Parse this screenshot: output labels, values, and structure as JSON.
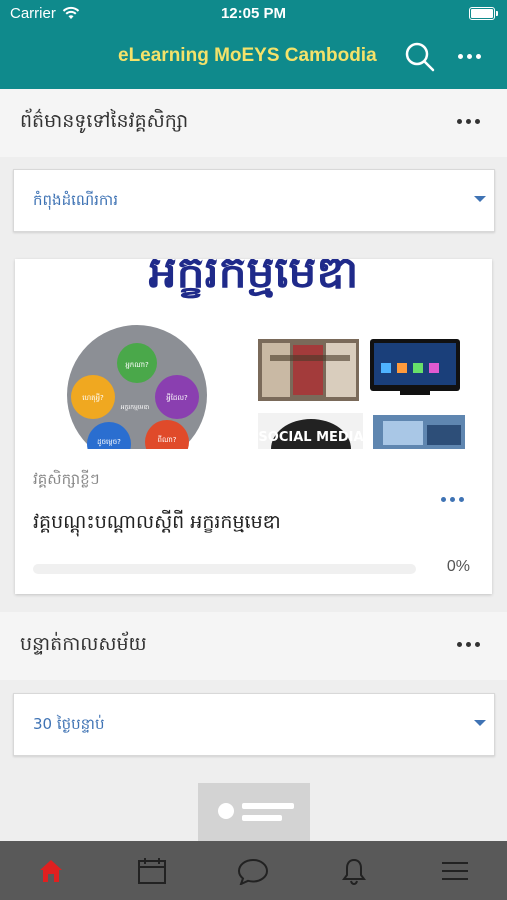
{
  "status_bar": {
    "carrier": "Carrier",
    "time": "12:05 PM"
  },
  "header": {
    "title": "eLearning MoEYS Cambodia",
    "search_icon": "search-icon",
    "more_icon": "more-icon"
  },
  "sections": {
    "news": {
      "title": "ព័ត៌មានទូទៅនៃវគ្គសិក្សា"
    },
    "course_filter": {
      "selected": "កំពុងដំណើរការ"
    },
    "timeline": {
      "title": "បន្ទាត់កាលសម័យ"
    },
    "timeline_filter": {
      "selected": "30 ថ្ងៃបន្ទាប់"
    }
  },
  "course": {
    "banner_title": "អក្ខរកម្មមេឌា",
    "banner_circle_labels": [
      "អ្នកណា?",
      "ហេតុអ្វី?",
      "អ្វីដែល?",
      "អក្ខរកម្មមេឌា",
      "ពីណា?",
      "ដូចម្តេច?"
    ],
    "banner_thumb_label": "SOCIAL MEDIA",
    "category": "វគ្គសិក្សាខ្លីៗ",
    "name": "វគ្គបណ្តុះបណ្តាលស្តីពី អក្ខរកម្មមេឌា",
    "progress": 0,
    "progress_label": "0%"
  },
  "colors": {
    "header_bg": "#0f8a8c",
    "title_yellow": "#f4e26a",
    "accent_blue": "#3f73b4",
    "tabbar_bg": "#595959",
    "active_tab": "#e02020"
  },
  "tabbar": {
    "items": [
      {
        "icon": "home-icon",
        "active": true
      },
      {
        "icon": "calendar-icon",
        "active": false
      },
      {
        "icon": "messages-icon",
        "active": false
      },
      {
        "icon": "bell-icon",
        "active": false
      },
      {
        "icon": "menu-icon",
        "active": false
      }
    ]
  }
}
